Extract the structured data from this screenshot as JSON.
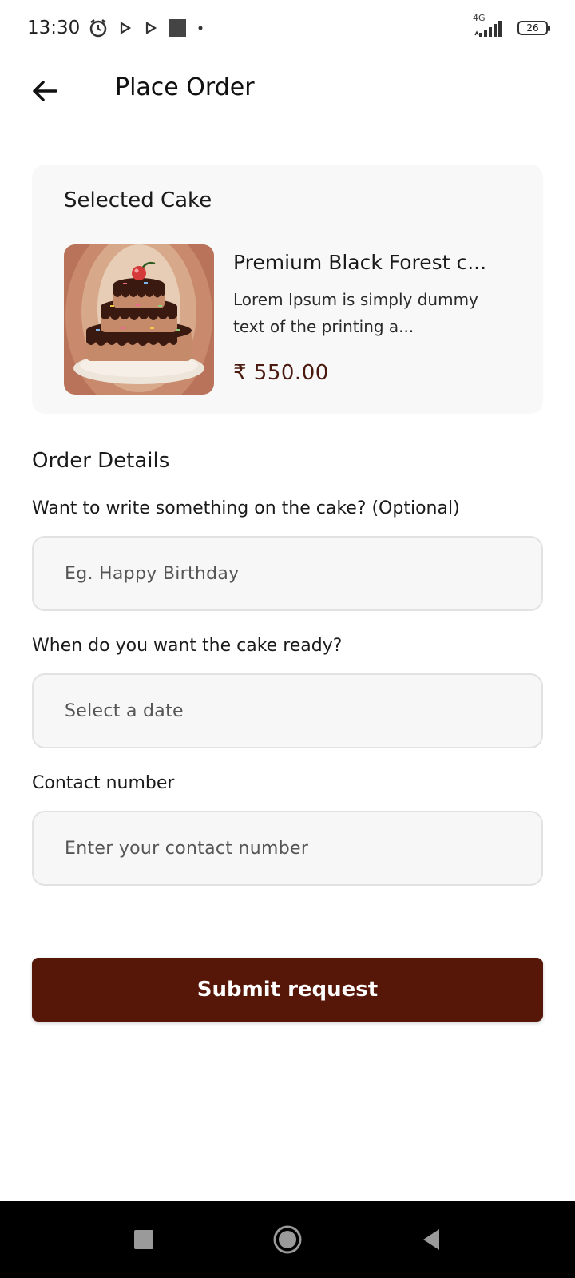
{
  "status_bar": {
    "time": "13:30",
    "network": "4G",
    "battery": "26",
    "icons": [
      "alarm-icon",
      "play-icon",
      "play-icon",
      "square-icon",
      "dot-icon",
      "signal-icon",
      "battery-icon"
    ]
  },
  "app_bar": {
    "title": "Place Order",
    "back_icon": "arrow-left-icon"
  },
  "selected_cake": {
    "title": "Selected Cake",
    "name": "Premium Black Forest c...",
    "description": "Lorem Ipsum is simply dummy text of the printing a...",
    "price": "₹ 550.00"
  },
  "order_details": {
    "title": "Order Details",
    "message_label": "Want to write something on the cake? (Optional)",
    "message_placeholder": "Eg. Happy Birthday",
    "date_label": "When do you want the cake ready?",
    "date_placeholder": "Select a date",
    "contact_label": "Contact number",
    "contact_placeholder": "Enter your contact number"
  },
  "submit_label": "Submit request",
  "colors": {
    "accent": "#571708",
    "card_bg": "#f8f8f8",
    "field_bg": "#f7f7f7",
    "price": "#4a1a10"
  }
}
